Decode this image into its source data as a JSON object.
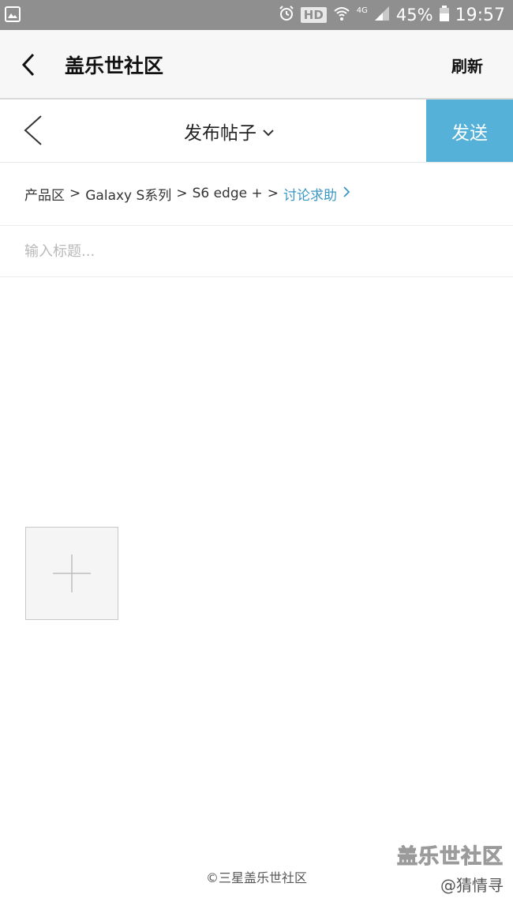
{
  "status_bar": {
    "hd_badge": "HD",
    "network_type": "4G",
    "battery_percent": "45%",
    "time": "19:57",
    "icons": [
      "gallery-icon",
      "alarm-icon",
      "wifi-icon",
      "signal-icon",
      "battery-icon"
    ]
  },
  "app_bar": {
    "title": "盖乐世社区",
    "refresh_label": "刷新"
  },
  "compose": {
    "post_type_label": "发布帖子",
    "send_label": "发送"
  },
  "breadcrumb": {
    "items": [
      "产品区",
      "Galaxy S系列",
      "S6 edge +"
    ],
    "separator": ">",
    "current": "讨论求助"
  },
  "title_field": {
    "value": "",
    "placeholder": "输入标题..."
  },
  "footer": {
    "copyright": "©三星盖乐世社区"
  },
  "watermark": {
    "brand": "盖乐世社区",
    "user": "@猜情寻"
  },
  "colors": {
    "status_bar": "#8f8f8f",
    "accent": "#55b1d8",
    "link": "#3a97c4",
    "app_bar_bg": "#f7f7f7"
  }
}
